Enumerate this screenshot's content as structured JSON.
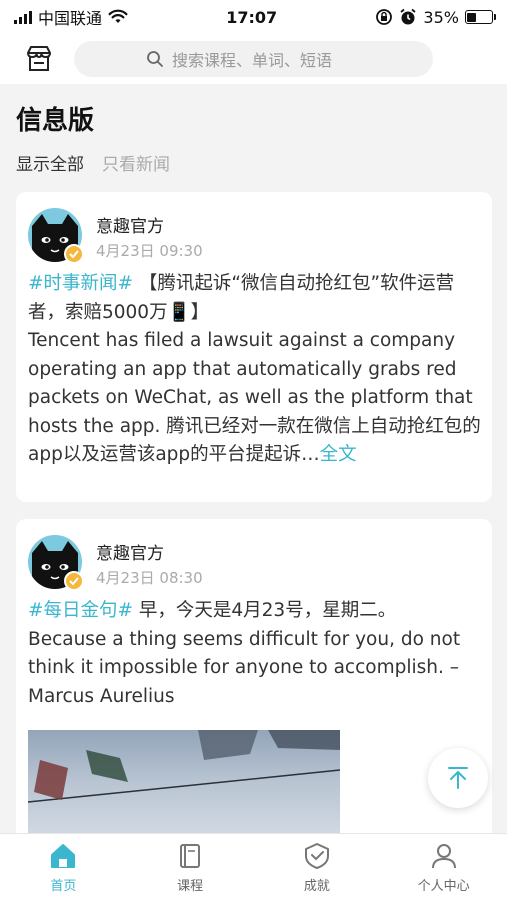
{
  "status_bar": {
    "carrier": "中国联通",
    "time": "17:07",
    "battery": "35%",
    "battery_level": 0.35
  },
  "search": {
    "placeholder": "搜索课程、单词、短语"
  },
  "page": {
    "title": "信息版",
    "filter_all": "显示全部",
    "filter_news": "只看新闻"
  },
  "posts": [
    {
      "author": "意趣官方",
      "time": "4月23日 09:30",
      "tag": "#时事新闻#",
      "text_cn": " 【腾讯起诉“微信自动抢红包”软件运营者，索赔5000万📱】",
      "text_en": "Tencent has filed a lawsuit against a company operating an app that automatically grabs red packets on WeChat, as well as the platform that hosts the app. 腾讯已经对一款在微信上自动抢红包的app以及运营该app的平台提起诉…",
      "more_label": "全文"
    },
    {
      "author": "意趣官方",
      "time": "4月23日 08:30",
      "tag": "#每日金句#",
      "text_cn": " 早，今天是4月23号，星期二。",
      "text_en": "Because a thing seems difficult for you, do not think it impossible for anyone to accomplish. – Marcus Aurelius"
    }
  ],
  "tabs": [
    {
      "label": "首页",
      "icon": "home-icon",
      "active": true
    },
    {
      "label": "课程",
      "icon": "book-icon",
      "active": false
    },
    {
      "label": "成就",
      "icon": "badge-icon",
      "active": false
    },
    {
      "label": "个人中心",
      "icon": "user-icon",
      "active": false
    }
  ],
  "colors": {
    "accent": "#3bb6cf",
    "verify_badge": "#f5b83c"
  }
}
